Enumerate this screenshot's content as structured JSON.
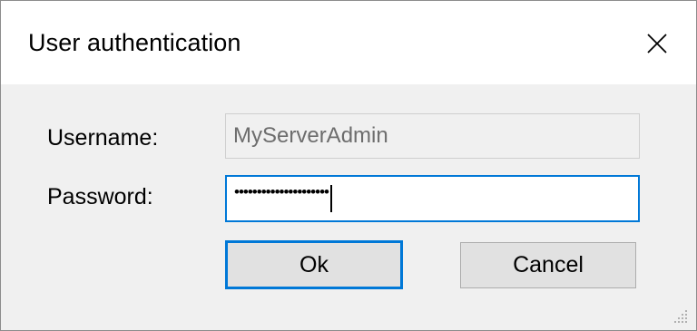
{
  "window": {
    "title": "User authentication",
    "close_icon": "close-icon",
    "grip_icon": "resize-grip-icon"
  },
  "form": {
    "username_label": "Username:",
    "username_value": "MyServerAdmin",
    "password_label": "Password:",
    "password_masked": "•••••••••••••••••••••"
  },
  "buttons": {
    "ok_label": "Ok",
    "cancel_label": "Cancel"
  },
  "colors": {
    "accent": "#0078d7",
    "dialog_background": "#f0f0f0",
    "button_face": "#e1e1e1",
    "disabled_text": "#6d6d6d"
  }
}
